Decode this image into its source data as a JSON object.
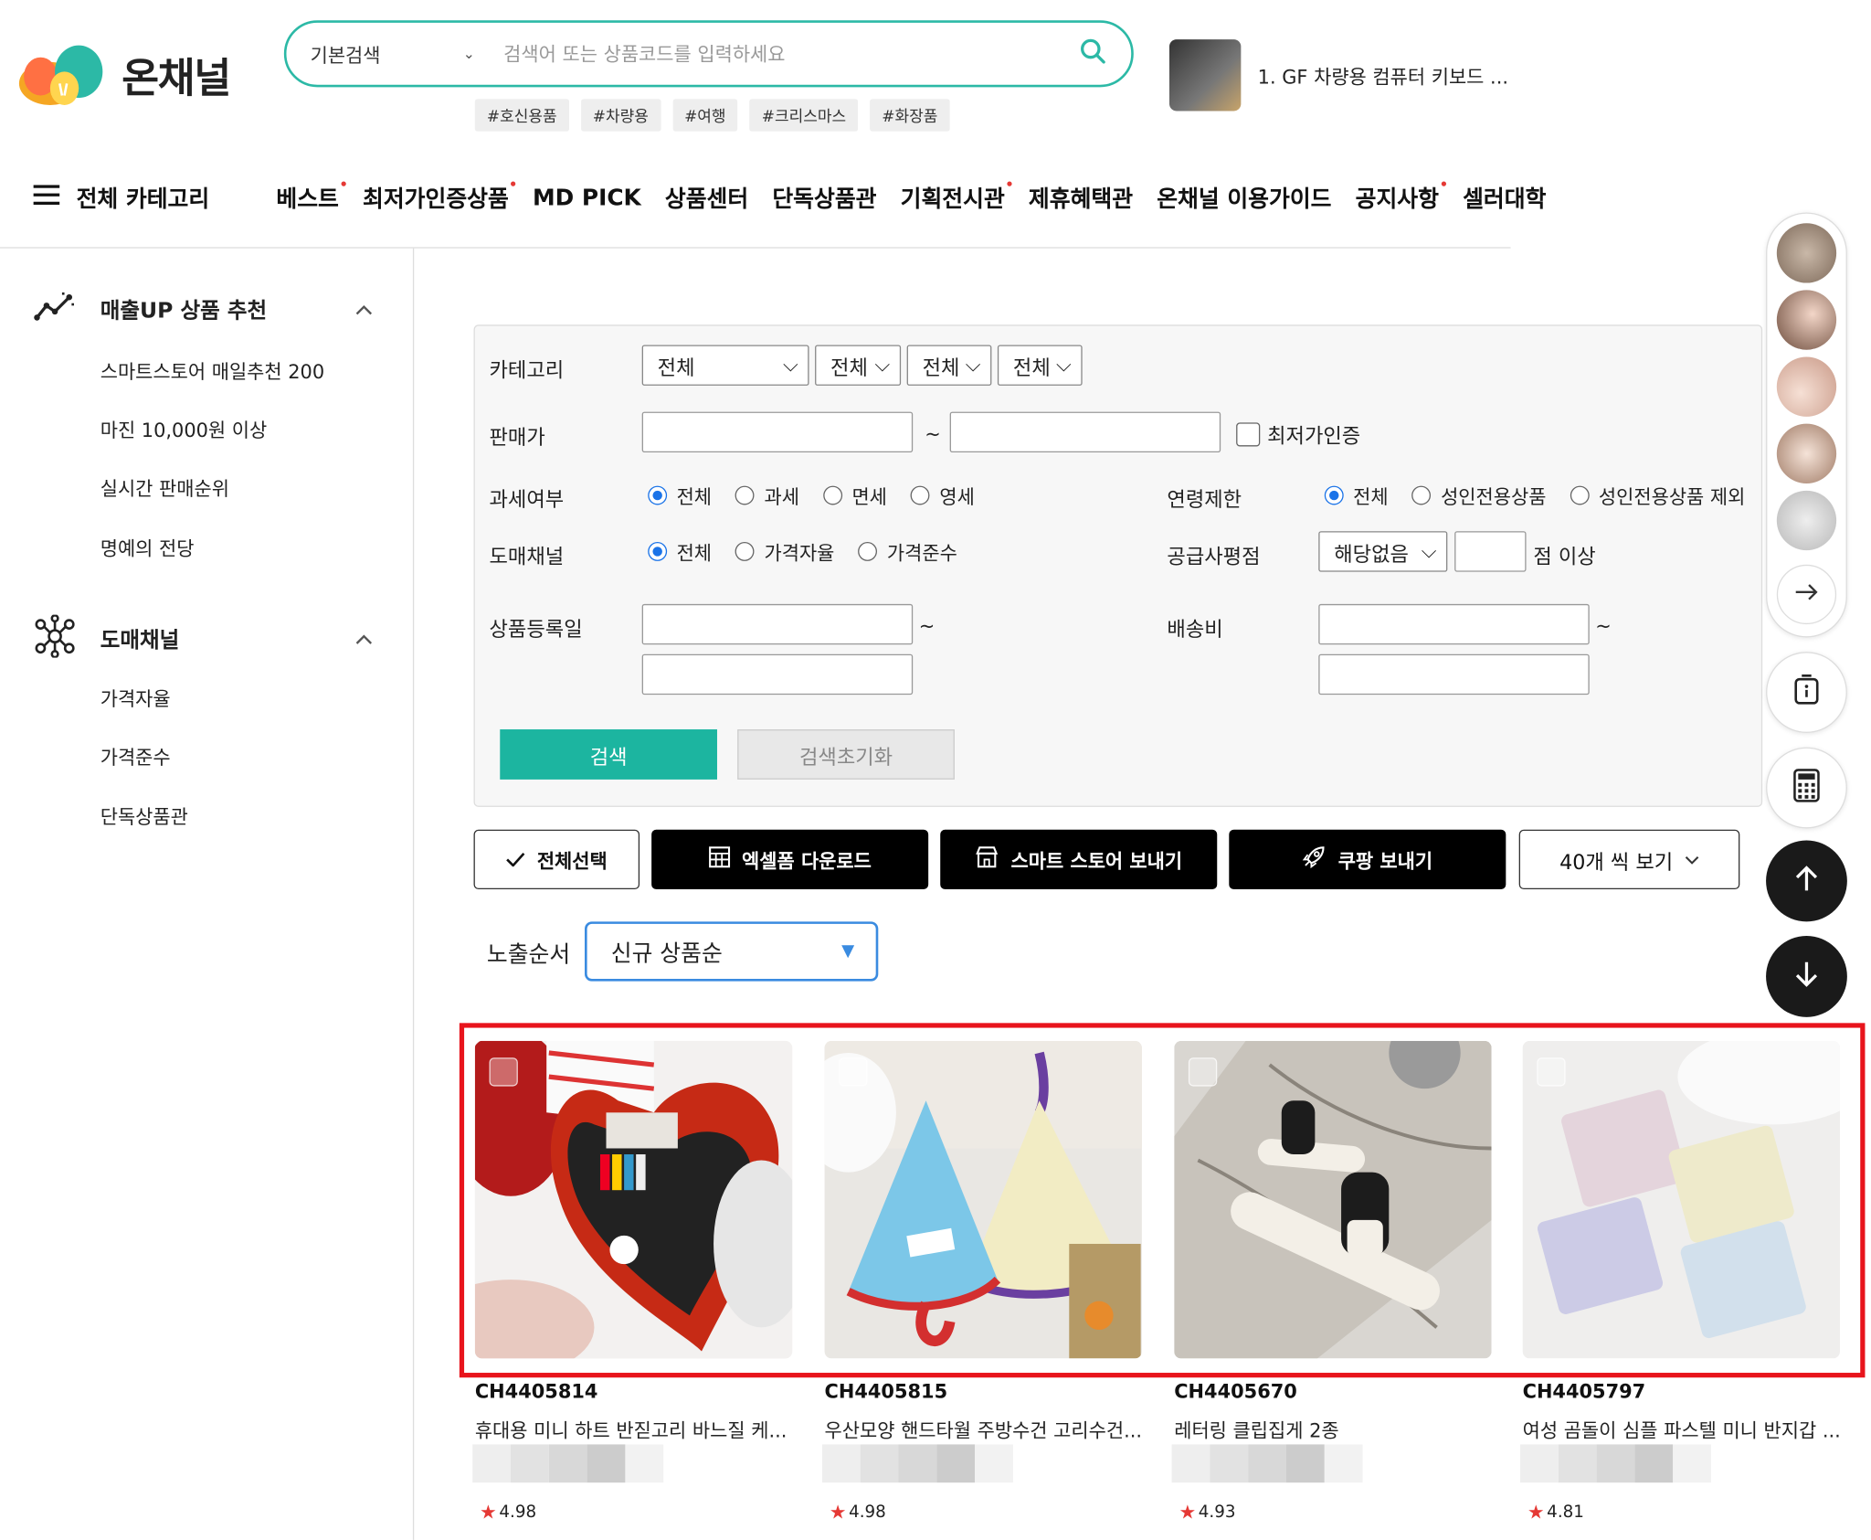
{
  "brand": {
    "name": "온채널"
  },
  "search": {
    "type_label": "기본검색",
    "placeholder": "검색어 또는 상품코드를 입력하세요"
  },
  "hashtags": [
    "#호신용품",
    "#차량용",
    "#여행",
    "#크리스마스",
    "#화장품"
  ],
  "ad_banner": {
    "text": "1. GF 차량용 컴퓨터 키보드 ..."
  },
  "gnb": {
    "all_category": "전체 카테고리",
    "items": [
      {
        "label": "베스트",
        "dot": true
      },
      {
        "label": "최저가인증상품",
        "dot": true
      },
      {
        "label": "MD PICK",
        "dot": false
      },
      {
        "label": "상품센터",
        "dot": false
      },
      {
        "label": "단독상품관",
        "dot": false
      },
      {
        "label": "기획전시관",
        "dot": true
      },
      {
        "label": "제휴혜택관",
        "dot": false
      },
      {
        "label": "온채널 이용가이드",
        "dot": false
      },
      {
        "label": "공지사항",
        "dot": true
      },
      {
        "label": "셀러대학",
        "dot": false
      }
    ]
  },
  "sidebar": {
    "sections": [
      {
        "title": "매출UP 상품 추천",
        "items": [
          "스마트스토어 매일추천 200",
          "마진 10,000원 이상",
          "실시간 판매순위",
          "명예의 전당"
        ]
      },
      {
        "title": "도매채널",
        "items": [
          "가격자율",
          "가격준수",
          "단독상품관"
        ]
      }
    ]
  },
  "filter": {
    "category": {
      "label": "카테고리",
      "selects": [
        "전체",
        "전체",
        "전체",
        "전체"
      ]
    },
    "price": {
      "label": "판매가",
      "tilde": "~",
      "lowest_cert": "최저가인증"
    },
    "tax": {
      "label": "과세여부",
      "options": [
        "전체",
        "과세",
        "면세",
        "영세"
      ],
      "selected": 0
    },
    "age": {
      "label": "연령제한",
      "options": [
        "전체",
        "성인전용상품",
        "성인전용상품 제외"
      ],
      "selected": 0
    },
    "channel": {
      "label": "도매채널",
      "options": [
        "전체",
        "가격자율",
        "가격준수"
      ],
      "selected": 0
    },
    "supplier": {
      "label": "공급사평점",
      "select": "해당없음",
      "suffix": "점 이상"
    },
    "reg_date": {
      "label": "상품등록일",
      "tilde": "~"
    },
    "shipping": {
      "label": "배송비",
      "tilde": "~"
    },
    "search_btn": "검색",
    "reset_btn": "검색초기화"
  },
  "actions": {
    "select_all": "전체선택",
    "excel": "엑셀폼 다운로드",
    "smartstore": "스마트 스토어 보내기",
    "coupang": "쿠팡 보내기",
    "per_page": "40개 씩 보기"
  },
  "order": {
    "label": "노출순서",
    "value": "신규 상품순"
  },
  "products": [
    {
      "code": "CH4405814",
      "name": "휴대용 미니 하트 반짇고리 바느질 케...",
      "rating": "4.98"
    },
    {
      "code": "CH4405815",
      "name": "우산모양 핸드타월 주방수건 고리수건...",
      "rating": "4.98"
    },
    {
      "code": "CH4405670",
      "name": "레터링 클립집게 2종",
      "rating": "4.93"
    },
    {
      "code": "CH4405797",
      "name": "여성 곰돌이 심플 파스텔 미니 반지갑 ...",
      "rating": "4.81"
    }
  ],
  "colors": {
    "accent": "#1cb5a0",
    "highlight": "#e8141c",
    "select_border": "#3a8be0"
  }
}
